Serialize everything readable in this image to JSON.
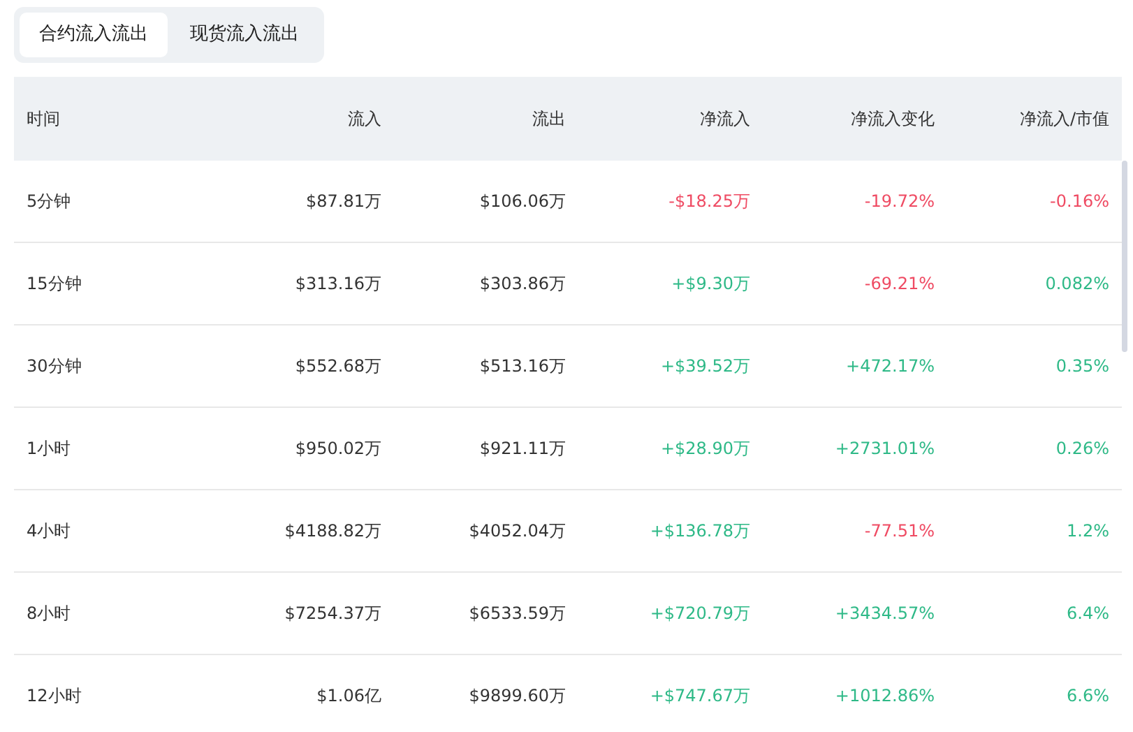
{
  "tabs": [
    {
      "label": "合约流入流出",
      "selected": true
    },
    {
      "label": "现货流入流出",
      "selected": false
    }
  ],
  "table": {
    "columns": [
      "时间",
      "流入",
      "流出",
      "净流入",
      "净流入变化",
      "净流入/市值"
    ],
    "rows": [
      {
        "time": "5分钟",
        "inflow": "$87.81万",
        "outflow": "$106.06万",
        "net": {
          "text": "-$18.25万",
          "color": "#ef4b63"
        },
        "change": {
          "text": "-19.72%",
          "color": "#ef4b63"
        },
        "ratio": {
          "text": "-0.16%",
          "color": "#ef4b63"
        }
      },
      {
        "time": "15分钟",
        "inflow": "$313.16万",
        "outflow": "$303.86万",
        "net": {
          "text": "+$9.30万",
          "color": "#2eb987"
        },
        "change": {
          "text": "-69.21%",
          "color": "#ef4b63"
        },
        "ratio": {
          "text": "0.082%",
          "color": "#2eb987"
        }
      },
      {
        "time": "30分钟",
        "inflow": "$552.68万",
        "outflow": "$513.16万",
        "net": {
          "text": "+$39.52万",
          "color": "#2eb987"
        },
        "change": {
          "text": "+472.17%",
          "color": "#2eb987"
        },
        "ratio": {
          "text": "0.35%",
          "color": "#2eb987"
        }
      },
      {
        "time": "1小时",
        "inflow": "$950.02万",
        "outflow": "$921.11万",
        "net": {
          "text": "+$28.90万",
          "color": "#2eb987"
        },
        "change": {
          "text": "+2731.01%",
          "color": "#2eb987"
        },
        "ratio": {
          "text": "0.26%",
          "color": "#2eb987"
        }
      },
      {
        "time": "4小时",
        "inflow": "$4188.82万",
        "outflow": "$4052.04万",
        "net": {
          "text": "+$136.78万",
          "color": "#2eb987"
        },
        "change": {
          "text": "-77.51%",
          "color": "#ef4b63"
        },
        "ratio": {
          "text": "1.2%",
          "color": "#2eb987"
        }
      },
      {
        "time": "8小时",
        "inflow": "$7254.37万",
        "outflow": "$6533.59万",
        "net": {
          "text": "+$720.79万",
          "color": "#2eb987"
        },
        "change": {
          "text": "+3434.57%",
          "color": "#2eb987"
        },
        "ratio": {
          "text": "6.4%",
          "color": "#2eb987"
        }
      },
      {
        "time": "12小时",
        "inflow": "$1.06亿",
        "outflow": "$9899.60万",
        "net": {
          "text": "+$747.67万",
          "color": "#2eb987"
        },
        "change": {
          "text": "+1012.86%",
          "color": "#2eb987"
        },
        "ratio": {
          "text": "6.6%",
          "color": "#2eb987"
        }
      }
    ]
  }
}
